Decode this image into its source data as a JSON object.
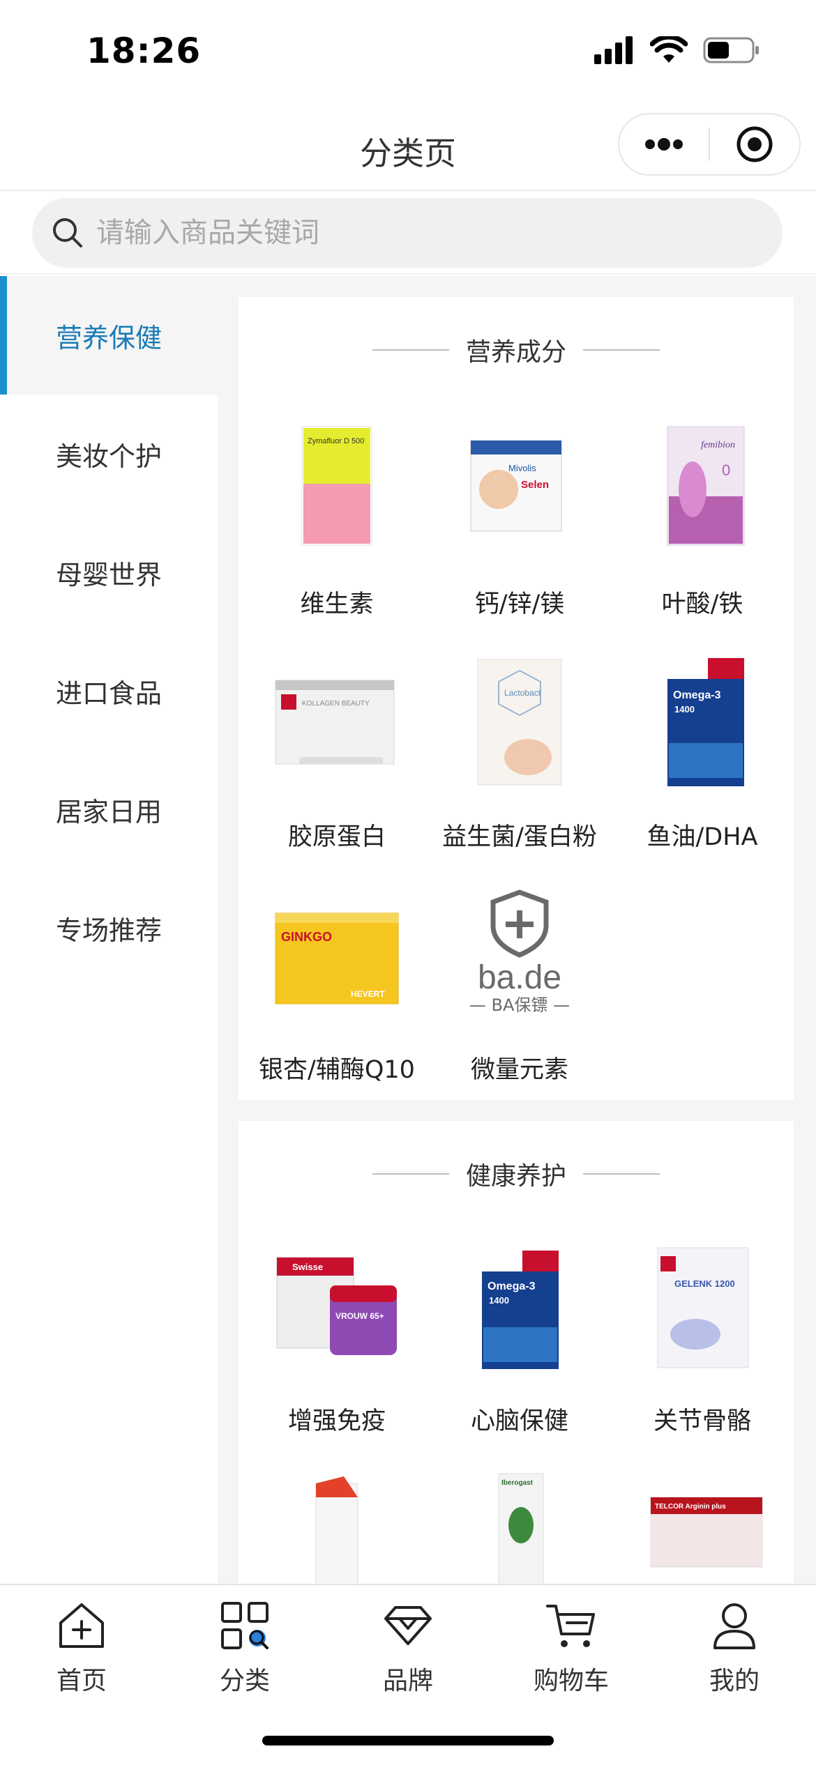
{
  "status": {
    "time": "18:26"
  },
  "nav": {
    "title": "分类页"
  },
  "search": {
    "placeholder": "请输入商品关键词"
  },
  "sidebar": {
    "items": [
      {
        "label": "营养保健",
        "active": true
      },
      {
        "label": "美妆个护",
        "active": false
      },
      {
        "label": "母婴世界",
        "active": false
      },
      {
        "label": "进口食品",
        "active": false
      },
      {
        "label": "居家日用",
        "active": false
      },
      {
        "label": "专场推荐",
        "active": false
      }
    ]
  },
  "sections": [
    {
      "title": "营养成分",
      "items": [
        {
          "label": "维生素",
          "brand_text": "Zymafluor D 500"
        },
        {
          "label": "钙/锌/镁",
          "brand_text": "Mivolis",
          "sub_text": "Selen"
        },
        {
          "label": "叶酸/铁",
          "brand_text": "femibion",
          "sub_text": "0"
        },
        {
          "label": "胶原蛋白",
          "brand_text": "KOLLAGEN BEAUTY"
        },
        {
          "label": "益生菌/蛋白粉",
          "brand_text": "Lactobact"
        },
        {
          "label": "鱼油/DHA",
          "brand_text": "Omega-3",
          "sub_text": "1400"
        },
        {
          "label": "银杏/辅酶Q10",
          "brand_text": "GINKGO",
          "sub_text": "HEVERT"
        },
        {
          "label": "微量元素",
          "brand_text": "ba.de",
          "sub_text": "— BA保镖 —"
        }
      ]
    },
    {
      "title": "健康养护",
      "items": [
        {
          "label": "增强免疫",
          "brand_text": "Swisse",
          "sub_text": "VROUW 65+"
        },
        {
          "label": "心脑保健",
          "brand_text": "Omega-3",
          "sub_text": "1400"
        },
        {
          "label": "关节骨骼",
          "brand_text": "GELENK 1200"
        },
        {
          "label": "",
          "brand_text": ""
        },
        {
          "label": "",
          "brand_text": "Iberogast"
        },
        {
          "label": "",
          "brand_text": "TELCOR Arginin plus"
        }
      ]
    }
  ],
  "tabbar": {
    "items": [
      {
        "label": "首页",
        "icon": "home-icon"
      },
      {
        "label": "分类",
        "icon": "category-icon"
      },
      {
        "label": "品牌",
        "icon": "diamond-icon"
      },
      {
        "label": "购物车",
        "icon": "cart-icon"
      },
      {
        "label": "我的",
        "icon": "user-icon"
      }
    ]
  },
  "colors": {
    "accent": "#1a8fce",
    "active_text": "#1a7bb6"
  }
}
